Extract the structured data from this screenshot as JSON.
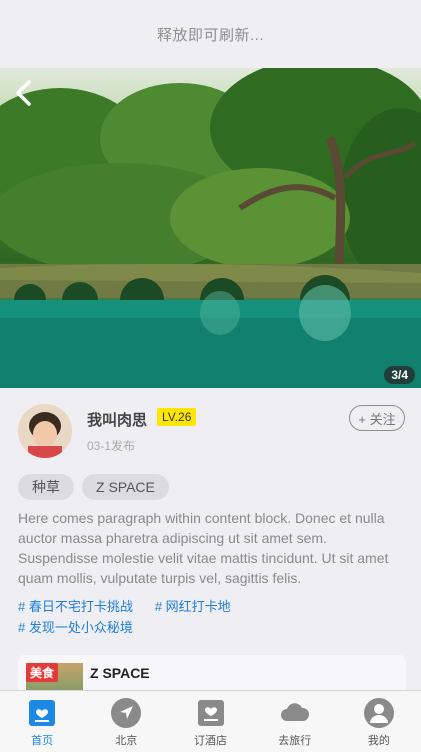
{
  "refresh_text": "释放即可刷新...",
  "hero": {
    "counter": "3/4"
  },
  "post": {
    "user_name": "我叫肉思",
    "level": "LV.26",
    "date": "03-1发布",
    "follow_label": "+ 关注",
    "tags": [
      "种草",
      "Z SPACE"
    ],
    "paragraph": "Here comes paragraph within content block. Donec et nulla auctor massa pharetra adipiscing ut sit amet sem. Suspendisse molestie velit vitae mattis tincidunt. Ut sit amet quam mollis, vulputate turpis vel, sagittis felis.",
    "hashtags": [
      "# 春日不宅打卡挑战",
      "# 网红打卡地",
      "# 发现一处小众秘境"
    ],
    "card": {
      "badge": "美食",
      "title": "Z SPACE"
    }
  },
  "tabbar": [
    {
      "label": "首页",
      "icon": "home-icon",
      "active": true
    },
    {
      "label": "北京",
      "icon": "location-icon",
      "active": false
    },
    {
      "label": "订酒店",
      "icon": "hotel-icon",
      "active": false
    },
    {
      "label": "去旅行",
      "icon": "cloud-icon",
      "active": false
    },
    {
      "label": "我的",
      "icon": "profile-icon",
      "active": false
    }
  ],
  "colors": {
    "accent": "#1e88e5",
    "level_badge": "#ffe600",
    "hashtag": "#1e7fd6",
    "card_badge": "#e53a3a"
  }
}
